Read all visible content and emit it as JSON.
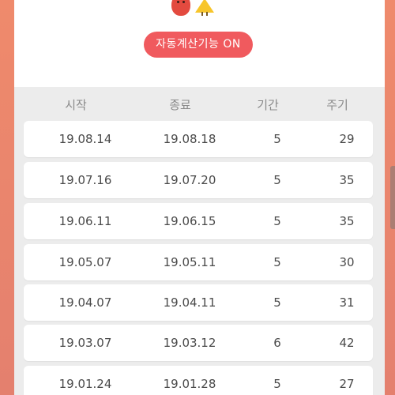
{
  "header": {
    "auto_calc_button": "자동계산기능 ON"
  },
  "table": {
    "columns": [
      "시작",
      "종료",
      "기간",
      "주기"
    ],
    "rows": [
      {
        "start": "19.08.14",
        "end": "19.08.18",
        "duration": "5",
        "cycle": "29"
      },
      {
        "start": "19.07.16",
        "end": "19.07.20",
        "duration": "5",
        "cycle": "35"
      },
      {
        "start": "19.06.11",
        "end": "19.06.15",
        "duration": "5",
        "cycle": "35"
      },
      {
        "start": "19.05.07",
        "end": "19.05.11",
        "duration": "5",
        "cycle": "30"
      },
      {
        "start": "19.04.07",
        "end": "19.04.11",
        "duration": "5",
        "cycle": "31"
      },
      {
        "start": "19.03.07",
        "end": "19.03.12",
        "duration": "6",
        "cycle": "42"
      },
      {
        "start": "19.01.24",
        "end": "19.01.28",
        "duration": "5",
        "cycle": "27"
      }
    ]
  },
  "colors": {
    "background": "#e9826a",
    "accent": "#f05a5e",
    "list_bg": "#ececec"
  }
}
